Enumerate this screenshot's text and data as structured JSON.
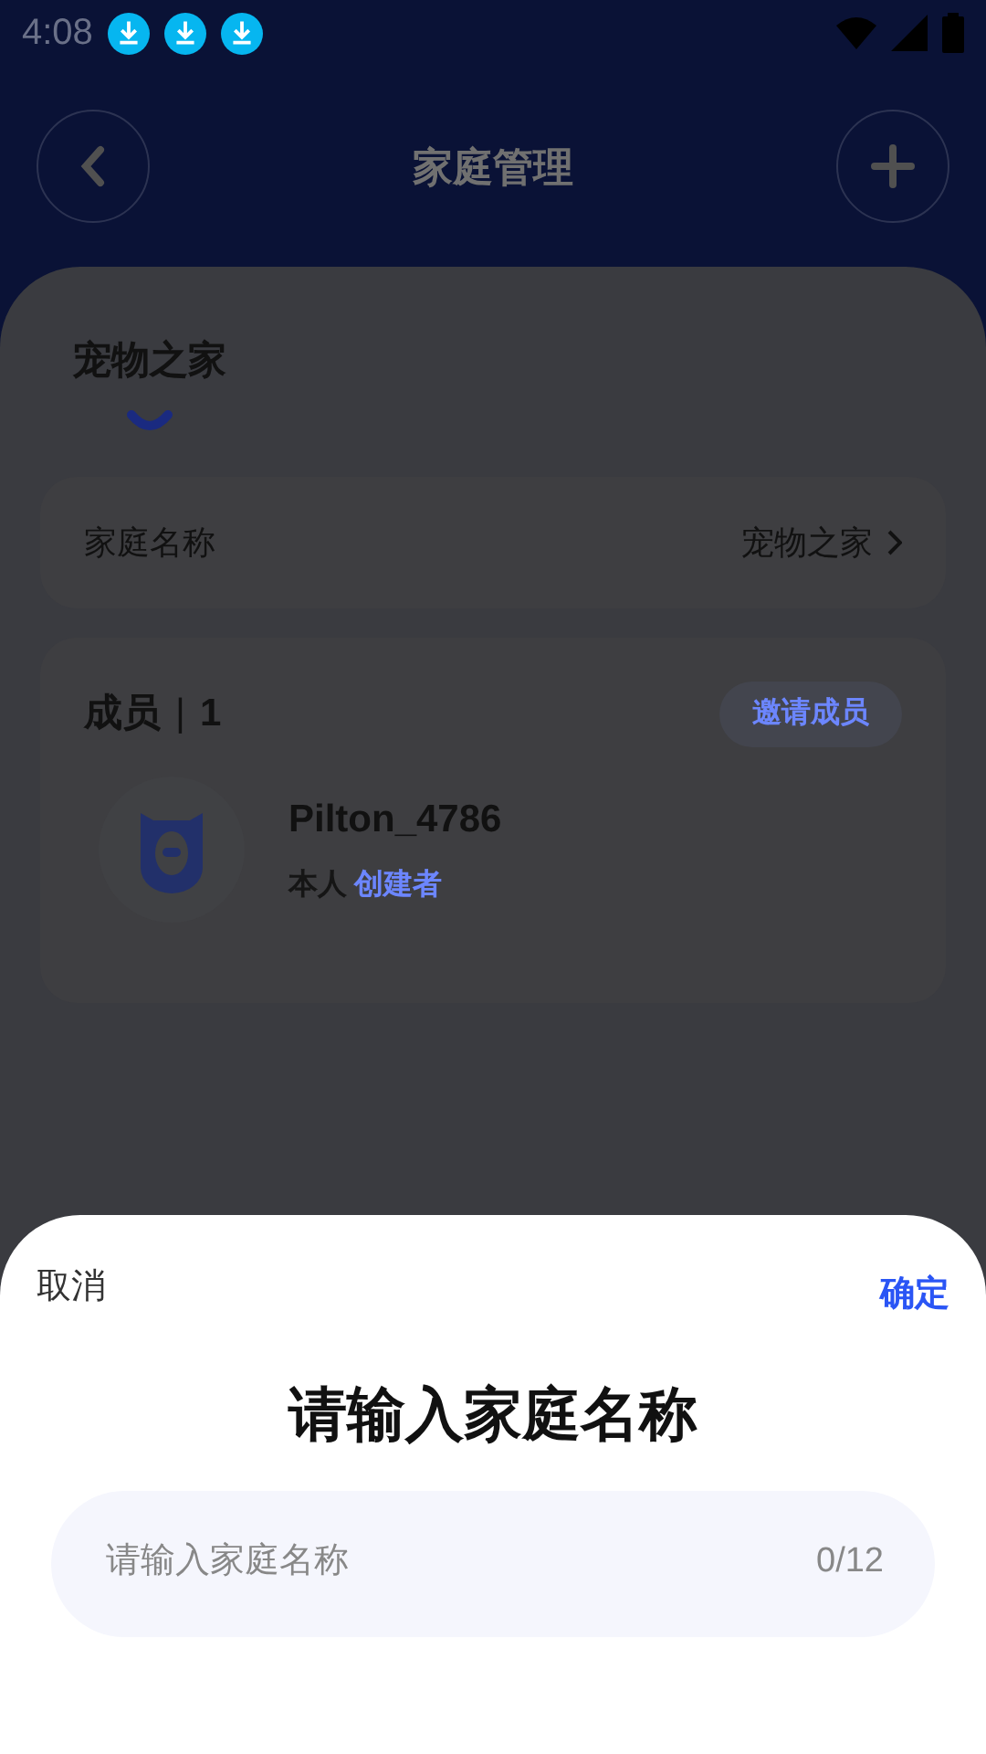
{
  "status_bar": {
    "time": "4:08"
  },
  "header": {
    "title": "家庭管理"
  },
  "family_tabs": [
    {
      "label": "宠物之家",
      "selected": true
    }
  ],
  "name_row": {
    "label": "家庭名称",
    "value": "宠物之家"
  },
  "members": {
    "title": "成员",
    "separator": "|",
    "count": "1",
    "invite_button": "邀请成员",
    "list": [
      {
        "name": "Pilton_4786",
        "tags": [
          {
            "text": "本人",
            "kind": "self"
          },
          {
            "text": "创建者",
            "kind": "role"
          }
        ]
      }
    ]
  },
  "dialog": {
    "cancel": "取消",
    "confirm": "确定",
    "title": "请输入家庭名称",
    "input": {
      "placeholder": "请输入家庭名称",
      "counter": "0/12"
    }
  }
}
